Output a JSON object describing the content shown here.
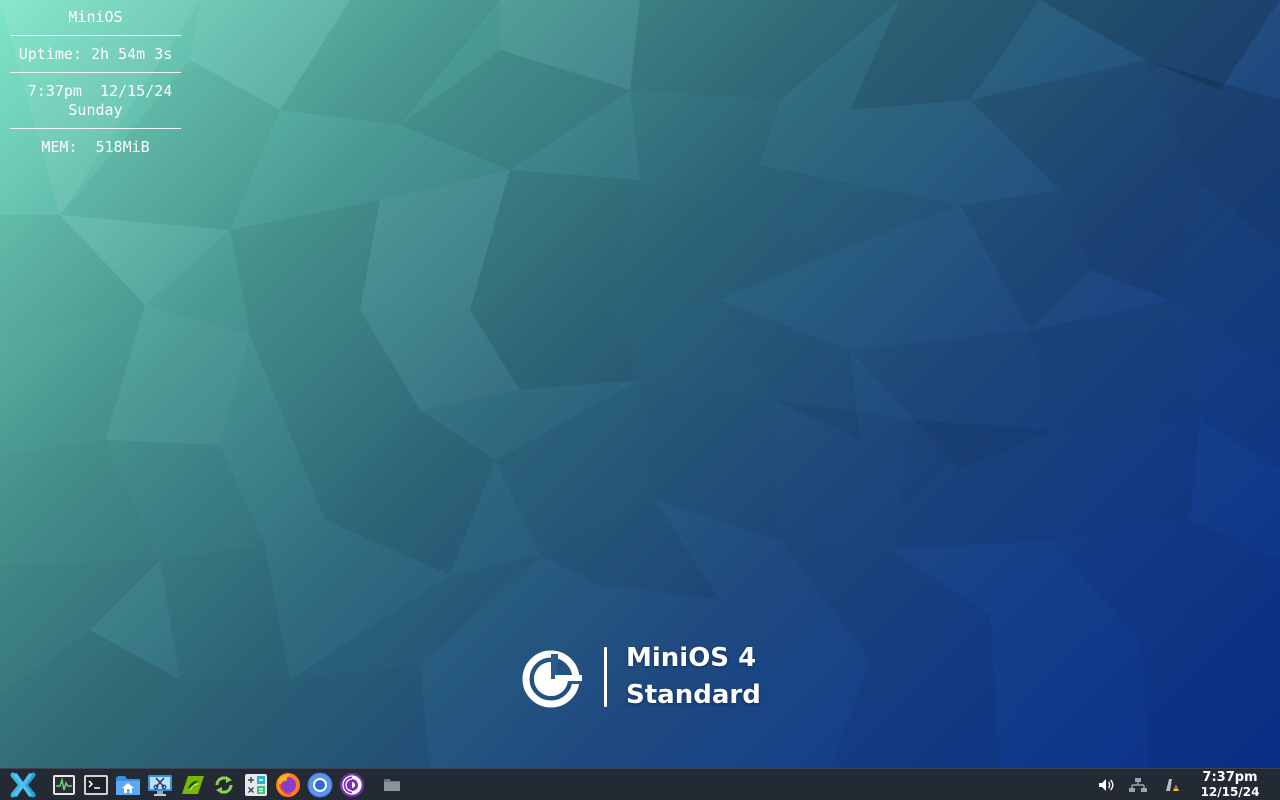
{
  "desktop": {
    "sysinfo": {
      "title": "MiniOS",
      "uptime": "Uptime: 2h 54m 3s",
      "datetime": " 7:37pm  12/15/24",
      "weekday": "Sunday",
      "memory": "MEM:  518MiB"
    },
    "branding": {
      "line1": "MiniOS 4",
      "line2": "Standard",
      "logo_icon": "minios-logo-icon"
    }
  },
  "taskbar": {
    "start_icon": "xfce-x-icon",
    "launchers": [
      "task-manager-icon",
      "terminal-icon",
      "file-manager-home-icon",
      "screenshot-icon",
      "nvidia-icon",
      "refresh-icon",
      "calculator-icon",
      "firefox-icon",
      "chromium-icon",
      "tor-browser-icon",
      "folder-icon"
    ],
    "tray": [
      "volume-icon",
      "network-icon",
      "update-notifier-icon"
    ],
    "clock": {
      "time": "7:37pm",
      "date": "12/15/24"
    }
  },
  "colors": {
    "taskbar_bg": "#242a33",
    "wallpaper_light": "#7fe6c8",
    "wallpaper_dark": "#0a2f8a",
    "text": "#ffffff"
  }
}
